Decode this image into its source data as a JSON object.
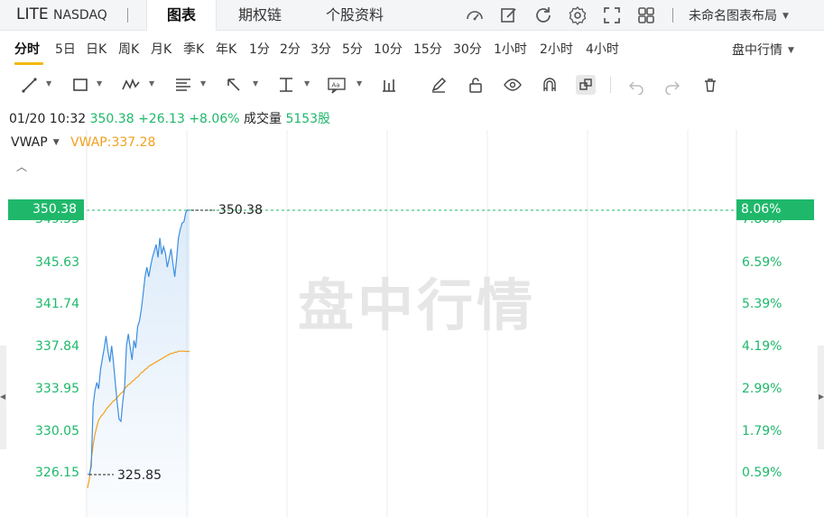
{
  "header": {
    "symbol": "LITE",
    "exchange": "NASDAQ",
    "tabs": [
      {
        "label": "图表",
        "active": true
      },
      {
        "label": "期权链",
        "active": false
      },
      {
        "label": "个股资料",
        "active": false
      }
    ],
    "icons": [
      "gauge-icon",
      "edit-icon",
      "refresh-icon",
      "settings-icon",
      "fullscreen-icon",
      "grid-layout-icon"
    ],
    "layout_name": "未命名图表布局"
  },
  "periods": {
    "items": [
      "分时",
      "5日",
      "日K",
      "周K",
      "月K",
      "季K",
      "年K",
      "1分",
      "2分",
      "3分",
      "5分",
      "10分",
      "15分",
      "30分",
      "1小时",
      "2小时",
      "4小时"
    ],
    "active": "分时",
    "session": "盘中行情"
  },
  "toolbar": {
    "tools": [
      "trendline-icon",
      "rectangle-icon",
      "pattern-icon",
      "fibonacci-icon",
      "arrow-icon",
      "measure-icon",
      "text-label-icon",
      "candle-icon",
      "pencil-icon",
      "lock-icon",
      "eye-icon",
      "magnet-icon",
      "link-icon",
      "undo-icon",
      "redo-icon",
      "trash-icon"
    ]
  },
  "quote": {
    "datetime": "01/20 10:32",
    "price": "350.38",
    "change": "+26.13",
    "change_pct": "+8.06%",
    "volume_label": "成交量",
    "volume": "5153股"
  },
  "indicator": {
    "name": "VWAP",
    "label": "VWAP:337.28"
  },
  "colors": {
    "up": "#1fb86b",
    "price_line": "#3b8ee0",
    "vwap_line": "#f2a01f",
    "active_underline": "#f2b90c"
  },
  "chart_data": {
    "type": "line",
    "ylim": [
      324.2,
      352.2
    ],
    "y_ticks_left": [
      "349.53",
      "345.63",
      "341.74",
      "337.84",
      "333.95",
      "330.05",
      "326.15"
    ],
    "y_ticks_right": [
      "7.80%",
      "6.59%",
      "5.39%",
      "4.19%",
      "2.99%",
      "1.79%",
      "0.59%"
    ],
    "last_price_label": "350.38",
    "last_pct_label": "8.06%",
    "high_annotation": "350.38",
    "low_annotation": "325.85",
    "watermark": "盘中行情",
    "series": [
      {
        "name": "Price",
        "values": [
          325.9,
          325.85,
          326.6,
          332.3,
          333.6,
          334.4,
          333.8,
          335.6,
          336.6,
          337.6,
          338.7,
          337.3,
          336.3,
          337.8,
          336.2,
          334.3,
          332.5,
          331.0,
          330.8,
          332.6,
          334.0,
          337.8,
          338.9,
          337.6,
          336.5,
          338.3,
          337.6,
          339.6,
          340.1,
          341.2,
          342.6,
          344.2,
          345.1,
          344.2,
          345.2,
          346.0,
          346.6,
          347.2,
          346.0,
          347.8,
          346.3,
          347.0,
          346.4,
          345.1,
          345.9,
          346.8,
          345.5,
          344.2,
          345.8,
          347.8,
          348.6,
          349.2,
          349.3,
          350.2,
          350.4,
          350.38
        ]
      },
      {
        "name": "VWAP",
        "values": [
          324.6,
          325.5,
          327.2,
          328.6,
          329.6,
          330.3,
          330.9,
          331.2,
          331.4,
          331.6,
          331.9,
          332.1,
          332.3,
          332.5,
          332.7,
          332.8,
          333.0,
          333.2,
          333.4,
          333.5,
          333.8,
          334.0,
          334.2,
          334.3,
          334.5,
          334.6,
          334.8,
          334.9,
          335.1,
          335.3,
          335.4,
          335.6,
          335.7,
          335.9,
          336.0,
          336.1,
          336.2,
          336.3,
          336.4,
          336.5,
          336.6,
          336.7,
          336.8,
          336.9,
          337.0,
          337.1,
          337.1,
          337.2,
          337.2,
          337.3,
          337.3,
          337.3,
          337.3,
          337.28,
          337.28,
          337.28
        ]
      }
    ]
  }
}
